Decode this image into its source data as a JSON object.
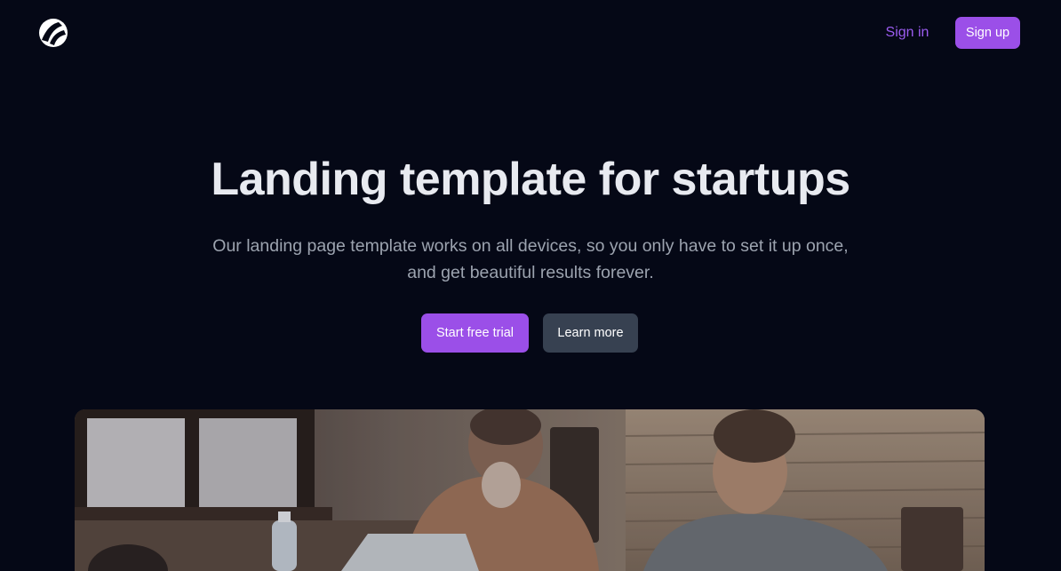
{
  "header": {
    "logo_icon": "brand-logo-icon",
    "signin_label": "Sign in",
    "signup_label": "Sign up"
  },
  "hero": {
    "title": "Landing template for startups",
    "subtitle": "Our landing page template works on all devices, so you only have to set it up once, and get beautiful results forever.",
    "primary_cta": "Start free trial",
    "secondary_cta": "Learn more",
    "image_description_icon": "team-working-photo"
  },
  "colors": {
    "background": "#050816",
    "accent": "#9b4fe8",
    "link": "#9b5cf0",
    "secondary_button": "#374151",
    "title": "#e8eaf0",
    "subtitle": "#9ca3af"
  }
}
